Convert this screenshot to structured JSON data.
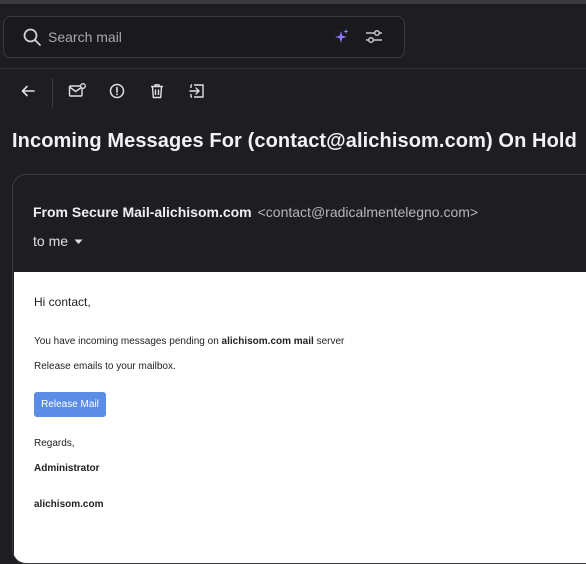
{
  "search": {
    "placeholder": "Search mail",
    "value": ""
  },
  "toolbar": {
    "back_icon": "back-arrow-icon",
    "mark_unread_icon": "mark-unread-icon",
    "report_spam_icon": "report-spam-icon",
    "delete_icon": "trash-icon",
    "move_icon": "move-to-icon"
  },
  "message": {
    "subject": "Incoming Messages For (contact@alichisom.com) On Hold",
    "sender_name": "From Secure Mail-alichisom.com",
    "sender_email": "<contact@radicalmentelegno.com>",
    "recipient": "to me",
    "body": {
      "greeting": "Hi contact,",
      "line1_prefix": "You have incoming messages pending on ",
      "line1_bold": "alichisom.com mail",
      "line1_suffix": " server",
      "line2": "Release emails to your mailbox.",
      "button_label": "Release Mail",
      "regards": "Regards,",
      "signature": "Administrator",
      "domain": "alichisom.com"
    }
  },
  "colors": {
    "background": "#1e1e22",
    "accent_sparkle": "#8b7cf6",
    "release_button": "#5b8de6"
  }
}
